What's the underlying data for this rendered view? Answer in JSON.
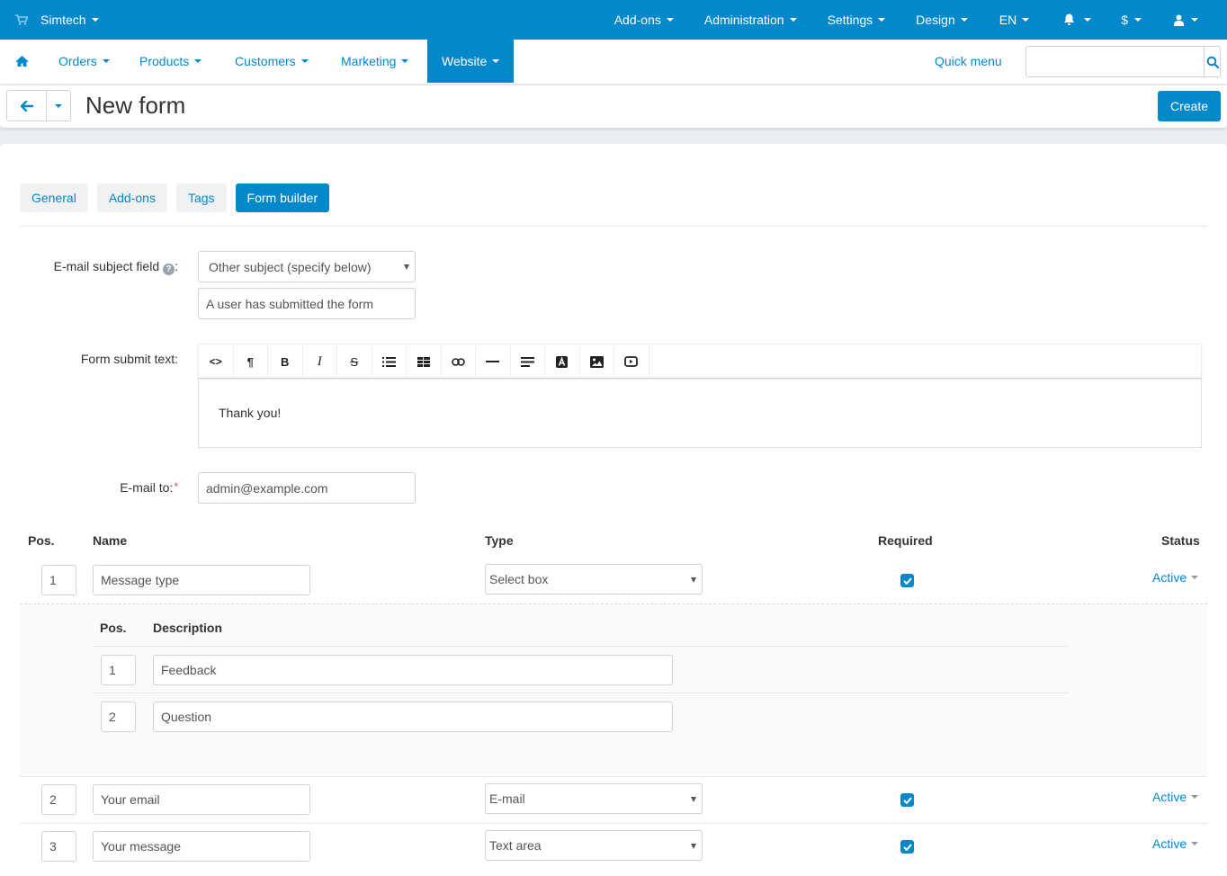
{
  "topbar": {
    "brand": "Simtech",
    "menu": [
      {
        "label": "Add-ons"
      },
      {
        "label": "Administration"
      },
      {
        "label": "Settings"
      },
      {
        "label": "Design"
      },
      {
        "label": "EN"
      }
    ],
    "icons": [
      "bell-icon",
      "currency-icon",
      "user-icon"
    ],
    "currency_label": "$"
  },
  "mainnav": {
    "items": [
      {
        "label": "Orders"
      },
      {
        "label": "Products"
      },
      {
        "label": "Customers"
      },
      {
        "label": "Marketing"
      },
      {
        "label": "Website",
        "active": true
      }
    ],
    "quick_menu": "Quick menu",
    "search": {
      "value": "",
      "placeholder": ""
    }
  },
  "header": {
    "title": "New form",
    "create_label": "Create"
  },
  "tabs": [
    {
      "label": "General"
    },
    {
      "label": "Add-ons"
    },
    {
      "label": "Tags"
    },
    {
      "label": "Form builder",
      "active": true
    }
  ],
  "form": {
    "subject_label": "E-mail subject field",
    "subject_select": "Other subject (specify below)",
    "subject_text": "A user has submitted the form",
    "submit_text_label": "Form submit text:",
    "submit_text": "Thank you!",
    "email_to_label": "E-mail to:",
    "email_to": "admin@example.com",
    "toolbar_buttons": [
      "code-view",
      "paragraph",
      "bold",
      "italic",
      "strikethrough",
      "unordered-list",
      "table",
      "link",
      "horizontal-rule",
      "align",
      "font-color",
      "image",
      "video"
    ]
  },
  "fields_table": {
    "headers": {
      "pos": "Pos.",
      "name": "Name",
      "type": "Type",
      "required": "Required",
      "status": "Status"
    },
    "rows": [
      {
        "pos": "1",
        "name": "Message type",
        "type": "Select box",
        "required": true,
        "status": "Active"
      },
      {
        "pos": "2",
        "name": "Your email",
        "type": "E-mail",
        "required": true,
        "status": "Active"
      },
      {
        "pos": "3",
        "name": "Your message",
        "type": "Text area",
        "required": true,
        "status": "Active"
      }
    ],
    "variants": {
      "headers": {
        "pos": "Pos.",
        "description": "Description"
      },
      "rows": [
        {
          "pos": "1",
          "description": "Feedback"
        },
        {
          "pos": "2",
          "description": "Question"
        }
      ]
    }
  },
  "colors": {
    "accent": "#0388cc",
    "required_star": "#e24a4a",
    "background": "#ebeef1"
  }
}
